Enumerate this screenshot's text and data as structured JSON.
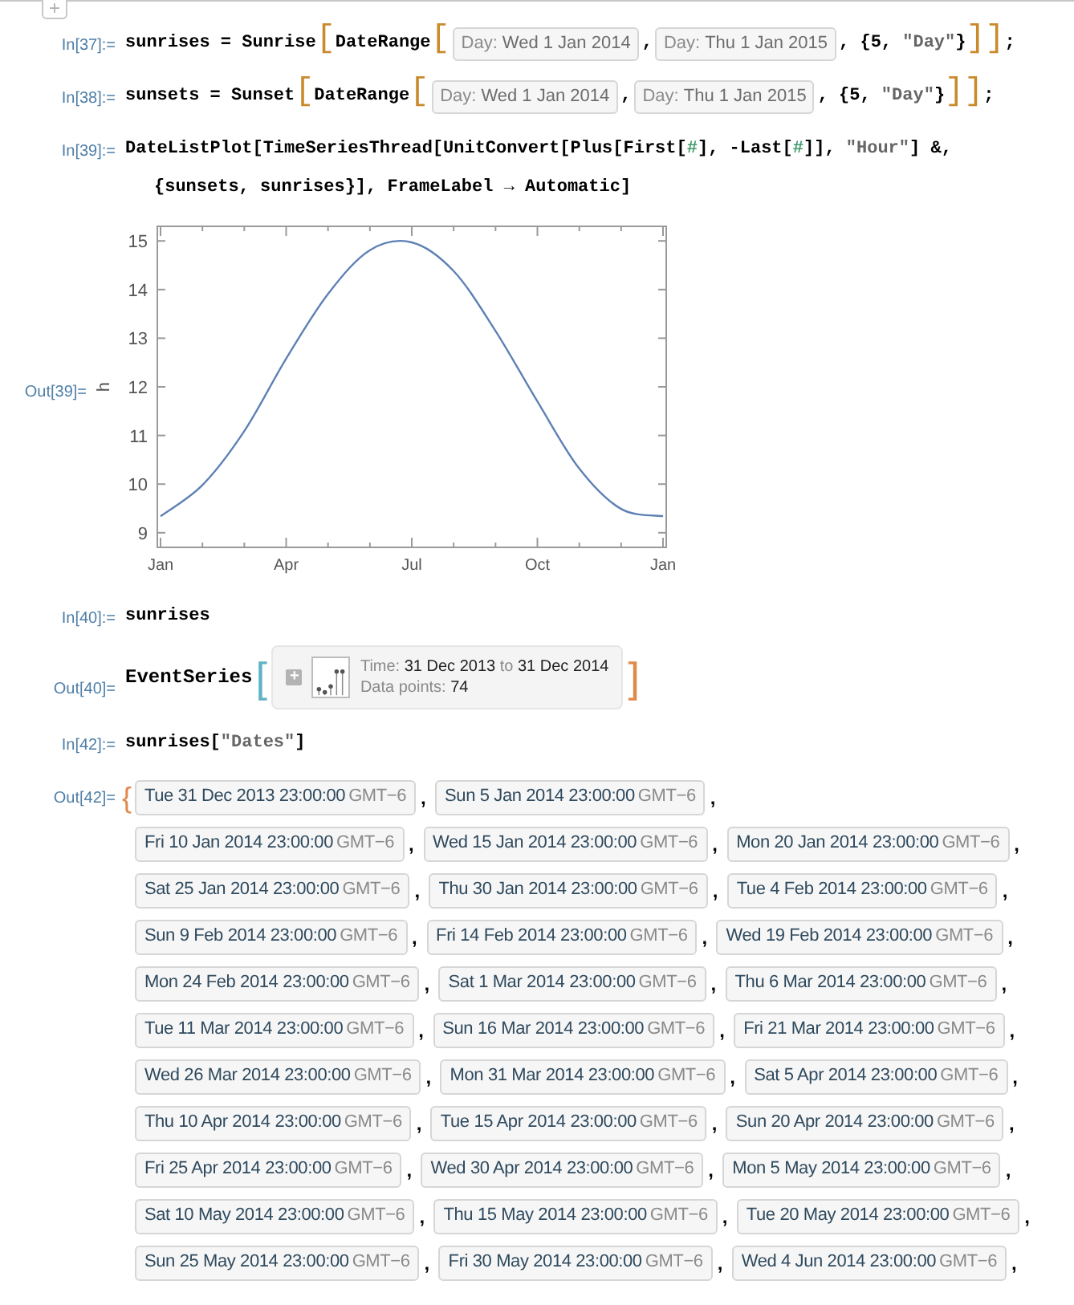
{
  "add_cell_button": "+",
  "cells": [
    {
      "kind": "input",
      "label": "In[37]:=",
      "lines": [
        [
          {
            "kind": "code",
            "text": "sunrises = Sunrise"
          },
          {
            "kind": "bracket",
            "text": "["
          },
          {
            "kind": "code",
            "text": "DateRange"
          },
          {
            "kind": "bracket",
            "text": "["
          },
          {
            "kind": "day",
            "label": "Day:",
            "value": "Wed 1 Jan 2014"
          },
          {
            "kind": "code",
            "text": ","
          },
          {
            "kind": "day",
            "label": "Day:",
            "value": "Thu 1 Jan 2015"
          },
          {
            "kind": "code",
            "text": ", {5, "
          },
          {
            "kind": "str",
            "text": "\"Day\""
          },
          {
            "kind": "code",
            "text": "}"
          },
          {
            "kind": "bracket",
            "text": "]"
          },
          {
            "kind": "bracket",
            "text": "]"
          },
          {
            "kind": "code",
            "text": ";"
          }
        ]
      ]
    },
    {
      "kind": "input",
      "label": "In[38]:=",
      "lines": [
        [
          {
            "kind": "code",
            "text": "sunsets = Sunset"
          },
          {
            "kind": "bracket",
            "text": "["
          },
          {
            "kind": "code",
            "text": "DateRange"
          },
          {
            "kind": "bracket",
            "text": "["
          },
          {
            "kind": "day",
            "label": "Day:",
            "value": "Wed 1 Jan 2014"
          },
          {
            "kind": "code",
            "text": ","
          },
          {
            "kind": "day",
            "label": "Day:",
            "value": "Thu 1 Jan 2015"
          },
          {
            "kind": "code",
            "text": ", {5, "
          },
          {
            "kind": "str",
            "text": "\"Day\""
          },
          {
            "kind": "code",
            "text": "}"
          },
          {
            "kind": "bracket",
            "text": "]"
          },
          {
            "kind": "bracket",
            "text": "]"
          },
          {
            "kind": "code",
            "text": ";"
          }
        ]
      ]
    },
    {
      "kind": "input",
      "label": "In[39]:=",
      "lines": [
        [
          {
            "kind": "code",
            "text": "DateListPlot[TimeSeriesThread[UnitConvert[Plus[First["
          },
          {
            "kind": "slot",
            "text": "#"
          },
          {
            "kind": "code",
            "text": "], -Last["
          },
          {
            "kind": "slot",
            "text": "#"
          },
          {
            "kind": "code",
            "text": "]], "
          },
          {
            "kind": "str",
            "text": "\"Hour\""
          },
          {
            "kind": "code",
            "text": "] &,"
          }
        ],
        [
          {
            "kind": "code",
            "text": "{sunsets, sunrises}], FrameLabel → Automatic]"
          }
        ]
      ]
    },
    {
      "kind": "plot",
      "label": "Out[39]=",
      "chart_data": {
        "type": "line",
        "ylabel": "h",
        "categories": [
          "Jan",
          null,
          null,
          "Apr",
          null,
          null,
          "Jul",
          null,
          null,
          "Oct",
          null,
          null,
          "Jan"
        ],
        "series": [
          {
            "color": "#5e81b5",
            "values": [
              9.34,
              9.98,
              11.09,
              12.58,
              13.91,
              14.81,
              14.97,
              14.38,
              13.15,
              11.7,
              10.32,
              9.49,
              9.34
            ]
          }
        ],
        "ylim": [
          8.7,
          15.3
        ],
        "yticks": [
          9,
          10,
          11,
          12,
          13,
          14,
          15
        ]
      }
    },
    {
      "kind": "input",
      "label": "In[40]:=",
      "lines": [
        [
          {
            "kind": "code",
            "text": "sunrises"
          }
        ]
      ]
    },
    {
      "kind": "event",
      "label": "Out[40]=",
      "head": "EventSeries",
      "open": "[",
      "close": "]",
      "expand": "+",
      "time_label": "Time:",
      "start": "31 Dec 2013",
      "to_word": "to",
      "end": "31 Dec 2014",
      "points_label": "Data points:",
      "points": "74"
    },
    {
      "kind": "input",
      "label": "In[42]:=",
      "lines": [
        [
          {
            "kind": "code",
            "text": "sunrises["
          },
          {
            "kind": "str",
            "text": "\"Dates\""
          },
          {
            "kind": "code",
            "text": "]"
          }
        ]
      ]
    },
    {
      "kind": "dates",
      "label": "Out[42]=",
      "open": "{",
      "rows": [
        [
          {
            "date": "Tue 31 Dec 2013 23:00:00",
            "zone": "GMT−6",
            "comma": ","
          },
          {
            "date": "Sun 5 Jan 2014 23:00:00",
            "zone": "GMT−6",
            "comma": ","
          }
        ],
        [
          {
            "date": "Fri 10 Jan 2014 23:00:00",
            "zone": "GMT−6",
            "comma": ","
          },
          {
            "date": "Wed 15 Jan 2014 23:00:00",
            "zone": "GMT−6",
            "comma": ","
          },
          {
            "date": "Mon 20 Jan 2014 23:00:00",
            "zone": "GMT−6",
            "comma": ","
          }
        ],
        [
          {
            "date": "Sat 25 Jan 2014 23:00:00",
            "zone": "GMT−6",
            "comma": ","
          },
          {
            "date": "Thu 30 Jan 2014 23:00:00",
            "zone": "GMT−6",
            "comma": ","
          },
          {
            "date": "Tue 4 Feb 2014 23:00:00",
            "zone": "GMT−6",
            "comma": ","
          }
        ],
        [
          {
            "date": "Sun 9 Feb 2014 23:00:00",
            "zone": "GMT−6",
            "comma": ","
          },
          {
            "date": "Fri 14 Feb 2014 23:00:00",
            "zone": "GMT−6",
            "comma": ","
          },
          {
            "date": "Wed 19 Feb 2014 23:00:00",
            "zone": "GMT−6",
            "comma": ","
          }
        ],
        [
          {
            "date": "Mon 24 Feb 2014 23:00:00",
            "zone": "GMT−6",
            "comma": ","
          },
          {
            "date": "Sat 1 Mar 2014 23:00:00",
            "zone": "GMT−6",
            "comma": ","
          },
          {
            "date": "Thu 6 Mar 2014 23:00:00",
            "zone": "GMT−6",
            "comma": ","
          }
        ],
        [
          {
            "date": "Tue 11 Mar 2014 23:00:00",
            "zone": "GMT−6",
            "comma": ","
          },
          {
            "date": "Sun 16 Mar 2014 23:00:00",
            "zone": "GMT−6",
            "comma": ","
          },
          {
            "date": "Fri 21 Mar 2014 23:00:00",
            "zone": "GMT−6",
            "comma": ","
          }
        ],
        [
          {
            "date": "Wed 26 Mar 2014 23:00:00",
            "zone": "GMT−6",
            "comma": ","
          },
          {
            "date": "Mon 31 Mar 2014 23:00:00",
            "zone": "GMT−6",
            "comma": ","
          },
          {
            "date": "Sat 5 Apr 2014 23:00:00",
            "zone": "GMT−6",
            "comma": ","
          }
        ],
        [
          {
            "date": "Thu 10 Apr 2014 23:00:00",
            "zone": "GMT−6",
            "comma": ","
          },
          {
            "date": "Tue 15 Apr 2014 23:00:00",
            "zone": "GMT−6",
            "comma": ","
          },
          {
            "date": "Sun 20 Apr 2014 23:00:00",
            "zone": "GMT−6",
            "comma": ","
          }
        ],
        [
          {
            "date": "Fri 25 Apr 2014 23:00:00",
            "zone": "GMT−6",
            "comma": ","
          },
          {
            "date": "Wed 30 Apr 2014 23:00:00",
            "zone": "GMT−6",
            "comma": ","
          },
          {
            "date": "Mon 5 May 2014 23:00:00",
            "zone": "GMT−6",
            "comma": ","
          }
        ],
        [
          {
            "date": "Sat 10 May 2014 23:00:00",
            "zone": "GMT−6",
            "comma": ","
          },
          {
            "date": "Thu 15 May 2014 23:00:00",
            "zone": "GMT−6",
            "comma": ","
          },
          {
            "date": "Tue 20 May 2014 23:00:00",
            "zone": "GMT−6",
            "comma": ","
          }
        ],
        [
          {
            "date": "Sun 25 May 2014 23:00:00",
            "zone": "GMT−6",
            "comma": ","
          },
          {
            "date": "Fri 30 May 2014 23:00:00",
            "zone": "GMT−6",
            "comma": ","
          },
          {
            "date": "Wed 4 Jun 2014 23:00:00",
            "zone": "GMT−6",
            "comma": ","
          }
        ]
      ]
    }
  ]
}
